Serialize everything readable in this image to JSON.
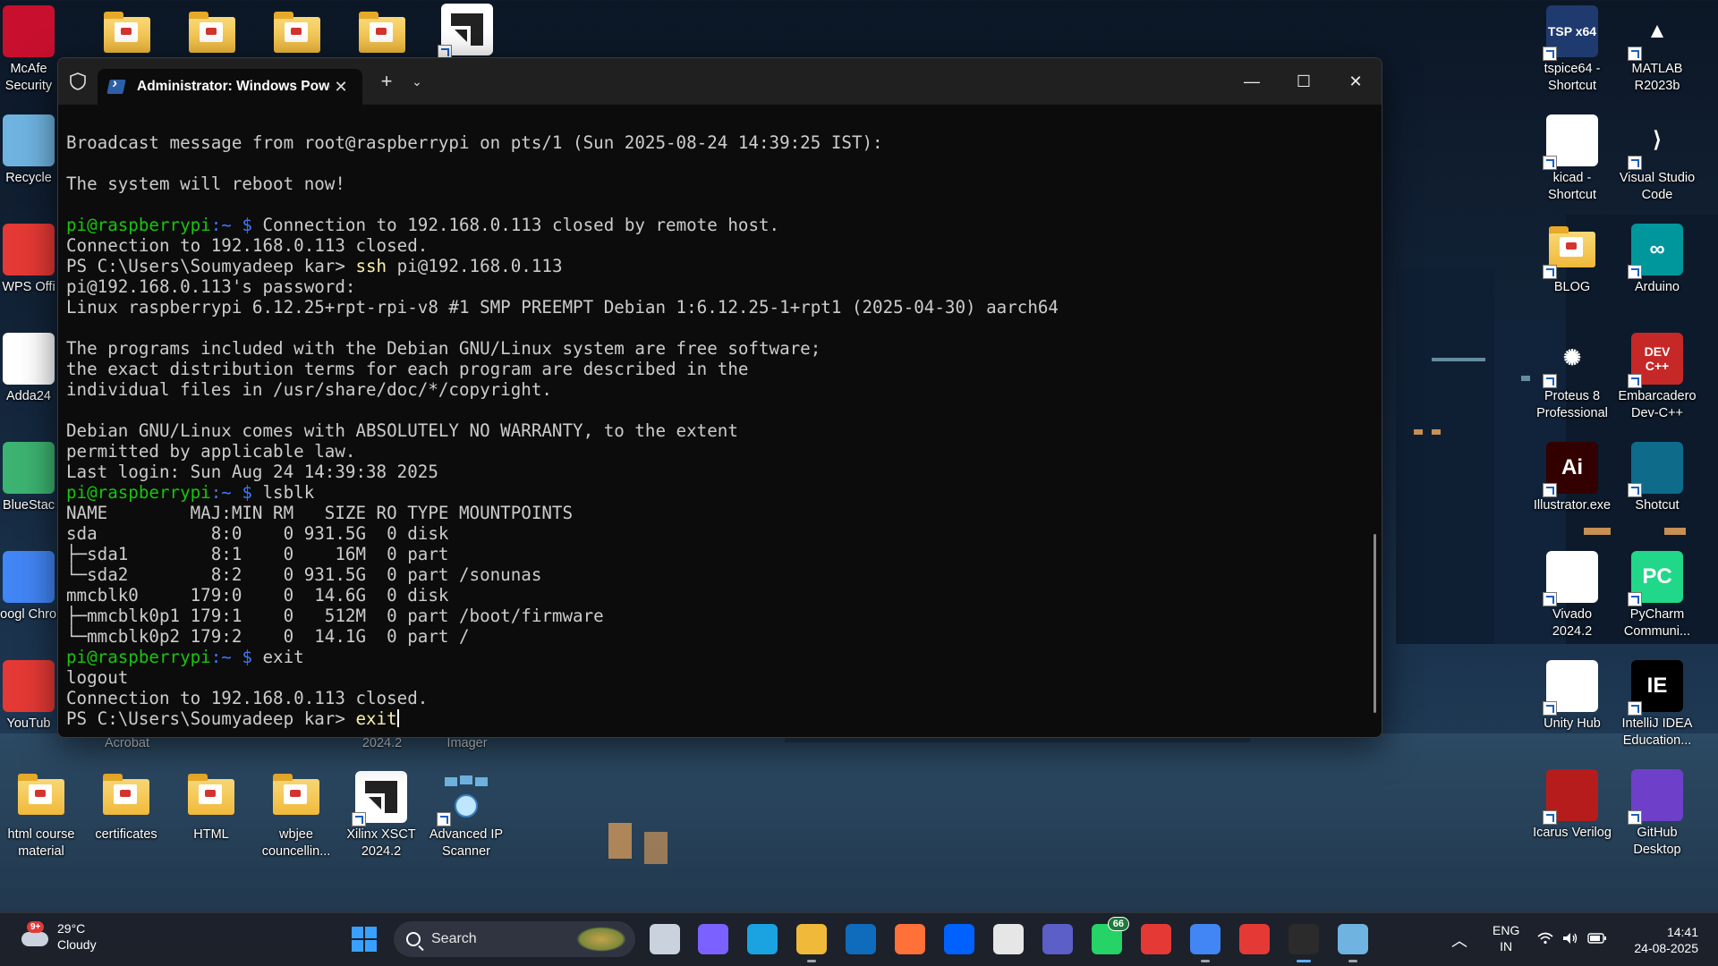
{
  "window": {
    "tab_title": "Administrator: Windows Powe",
    "console_lines": [
      [
        {
          "t": ""
        }
      ],
      [
        {
          "t": "Broadcast message from root@raspberrypi on pts/1 (Sun 2025-08-24 14:39:25 IST):"
        }
      ],
      [
        {
          "t": ""
        }
      ],
      [
        {
          "t": "The system will reboot now!"
        }
      ],
      [
        {
          "t": ""
        }
      ],
      [
        {
          "t": "pi@raspberrypi",
          "c": "g"
        },
        {
          "t": ":~ $",
          "c": "bl"
        },
        {
          "t": " Connection to 192.168.0.113 closed by remote host."
        }
      ],
      [
        {
          "t": "Connection to 192.168.0.113 closed."
        }
      ],
      [
        {
          "t": "PS C:\\Users\\Soumyadeep kar> "
        },
        {
          "t": "ssh",
          "c": "y"
        },
        {
          "t": " pi@192.168.0.113"
        }
      ],
      [
        {
          "t": "pi@192.168.0.113's password:"
        }
      ],
      [
        {
          "t": "Linux raspberrypi 6.12.25+rpt-rpi-v8 #1 SMP PREEMPT Debian 1:6.12.25-1+rpt1 (2025-04-30) aarch64"
        }
      ],
      [
        {
          "t": ""
        }
      ],
      [
        {
          "t": "The programs included with the Debian GNU/Linux system are free software;"
        }
      ],
      [
        {
          "t": "the exact distribution terms for each program are described in the"
        }
      ],
      [
        {
          "t": "individual files in /usr/share/doc/*/copyright."
        }
      ],
      [
        {
          "t": ""
        }
      ],
      [
        {
          "t": "Debian GNU/Linux comes with ABSOLUTELY NO WARRANTY, to the extent"
        }
      ],
      [
        {
          "t": "permitted by applicable law."
        }
      ],
      [
        {
          "t": "Last login: Sun Aug 24 14:39:38 2025"
        }
      ],
      [
        {
          "t": "pi@raspberrypi",
          "c": "g"
        },
        {
          "t": ":~ $",
          "c": "bl"
        },
        {
          "t": " lsblk"
        }
      ],
      [
        {
          "t": "NAME        MAJ:MIN RM   SIZE RO TYPE MOUNTPOINTS"
        }
      ],
      [
        {
          "t": "sda           8:0    0 931.5G  0 disk"
        }
      ],
      [
        {
          "t": "├─sda1        8:1    0    16M  0 part"
        }
      ],
      [
        {
          "t": "└─sda2        8:2    0 931.5G  0 part /sonunas"
        }
      ],
      [
        {
          "t": "mmcblk0     179:0    0  14.6G  0 disk"
        }
      ],
      [
        {
          "t": "├─mmcblk0p1 179:1    0   512M  0 part /boot/firmware"
        }
      ],
      [
        {
          "t": "└─mmcblk0p2 179:2    0  14.1G  0 part /"
        }
      ],
      [
        {
          "t": "pi@raspberrypi",
          "c": "g"
        },
        {
          "t": ":~ $",
          "c": "bl"
        },
        {
          "t": " exit"
        }
      ],
      [
        {
          "t": "logout"
        }
      ],
      [
        {
          "t": "Connection to 192.168.0.113 closed."
        }
      ],
      [
        {
          "t": "PS C:\\Users\\Soumyadeep kar> "
        },
        {
          "t": "exit",
          "c": "y"
        },
        {
          "t": "",
          "cursor": true
        }
      ]
    ]
  },
  "desktop": {
    "left_icons": [
      {
        "name": "mcafee-icon",
        "label": "McAfe Security",
        "color": "#c8102e"
      },
      {
        "name": "recycle-bin-icon",
        "label": "Recycle",
        "color": "#6fb3e0"
      },
      {
        "name": "wps-office-icon",
        "label": "WPS Offi",
        "color": "#e53935"
      },
      {
        "name": "adda247-icon",
        "label": "Adda24",
        "color": "#ffffff"
      },
      {
        "name": "bluestacks-icon",
        "label": "BlueStac",
        "color": "#3cb371"
      },
      {
        "name": "google-chrome-icon",
        "label": "Googl Chrom",
        "color": "#4285f4"
      },
      {
        "name": "youtube-icon",
        "label": "YouTub",
        "color": "#e53935"
      }
    ],
    "top_icons": [
      "folder",
      "folder",
      "folder",
      "folder",
      "vivado"
    ],
    "partial_labels": [
      "Acrobat",
      "2024.2",
      "Imager"
    ],
    "bottom_icons": [
      {
        "name": "html-course-material-folder",
        "label": "html course material"
      },
      {
        "name": "certificates-folder",
        "label": "certificates"
      },
      {
        "name": "html-folder",
        "label": "HTML"
      },
      {
        "name": "wbjee-councelling-folder",
        "label": "wbjee councellin..."
      },
      {
        "name": "xilinx-xsct-icon",
        "label": "Xilinx XSCT 2024.2"
      },
      {
        "name": "advanced-ip-scanner-icon",
        "label": "Advanced IP Scanner"
      }
    ],
    "right_icons": [
      {
        "name": "tspice64-icon",
        "label": "tspice64 - Shortcut",
        "bg": "#1f3a6e",
        "glyph": "TSP x64"
      },
      {
        "name": "matlab-icon",
        "label": "MATLAB R2023b",
        "bg": "transparent",
        "glyph": "▲"
      },
      {
        "name": "kicad-icon",
        "label": "kicad - Shortcut",
        "bg": "#ffffff",
        "glyph": ""
      },
      {
        "name": "vscode-icon",
        "label": "Visual Studio Code",
        "bg": "transparent",
        "glyph": "⟩"
      },
      {
        "name": "blog-folder",
        "label": "BLOG",
        "bg": "folder",
        "glyph": ""
      },
      {
        "name": "arduino-icon",
        "label": "Arduino",
        "bg": "#00979c",
        "glyph": "∞"
      },
      {
        "name": "proteus-icon",
        "label": "Proteus 8 Professional",
        "bg": "transparent",
        "glyph": "✺"
      },
      {
        "name": "embarcadero-devcpp-icon",
        "label": "Embarcadero Dev-C++",
        "bg": "#c62828",
        "glyph": "DEV C++"
      },
      {
        "name": "illustrator-icon",
        "label": "Illustrator.exe",
        "bg": "#330000",
        "glyph": "Ai"
      },
      {
        "name": "shotcut-icon",
        "label": "Shotcut",
        "bg": "#0e6b8a",
        "glyph": ""
      },
      {
        "name": "vivado-icon",
        "label": "Vivado 2024.2",
        "bg": "#ffffff",
        "glyph": ""
      },
      {
        "name": "pycharm-icon",
        "label": "PyCharm Communi...",
        "bg": "#21d789",
        "glyph": "PC"
      },
      {
        "name": "unity-hub-icon",
        "label": "Unity Hub",
        "bg": "#ffffff",
        "glyph": ""
      },
      {
        "name": "intellij-idea-icon",
        "label": "IntelliJ IDEA Education...",
        "bg": "#000000",
        "glyph": "IE"
      },
      {
        "name": "icarus-verilog-icon",
        "label": "Icarus Verilog",
        "bg": "#b71c1c",
        "glyph": ""
      },
      {
        "name": "github-desktop-icon",
        "label": "GitHub Desktop",
        "bg": "#6e40c9",
        "glyph": ""
      }
    ]
  },
  "taskbar": {
    "weather": {
      "temp": "29°C",
      "cond": "Cloudy",
      "badge": "9+"
    },
    "search_placeholder": "Search",
    "apps": [
      {
        "name": "start-button-icon",
        "color": "#3aa0ff"
      },
      {
        "name": "task-view-icon",
        "color": "#c9d2dd"
      },
      {
        "name": "copilot-icon",
        "color": "#7b61ff"
      },
      {
        "name": "edge-icon",
        "color": "#1aa3e0"
      },
      {
        "name": "file-explorer-icon",
        "color": "#f0b93a"
      },
      {
        "name": "outlook-icon",
        "color": "#0f6cbd"
      },
      {
        "name": "firefox-icon",
        "color": "#ff7139"
      },
      {
        "name": "dropbox-icon",
        "color": "#0061fe"
      },
      {
        "name": "amazon-icon",
        "color": "#e6e6e6"
      },
      {
        "name": "microsoft365-icon",
        "color": "#5b5fc7"
      },
      {
        "name": "whatsapp-icon",
        "color": "#25d366",
        "badge": "66"
      },
      {
        "name": "wps-taskbar-icon",
        "color": "#e53935"
      },
      {
        "name": "chrome-taskbar-icon",
        "color": "#4285f4"
      },
      {
        "name": "youtube-taskbar-icon",
        "color": "#e53935"
      },
      {
        "name": "terminal-taskbar-icon",
        "color": "#2b2b2b"
      },
      {
        "name": "network-scanner-taskbar-icon",
        "color": "#6fb3e0"
      }
    ],
    "lang1": "ENG",
    "lang2": "IN",
    "time": "14:41",
    "date": "24-08-2025"
  }
}
